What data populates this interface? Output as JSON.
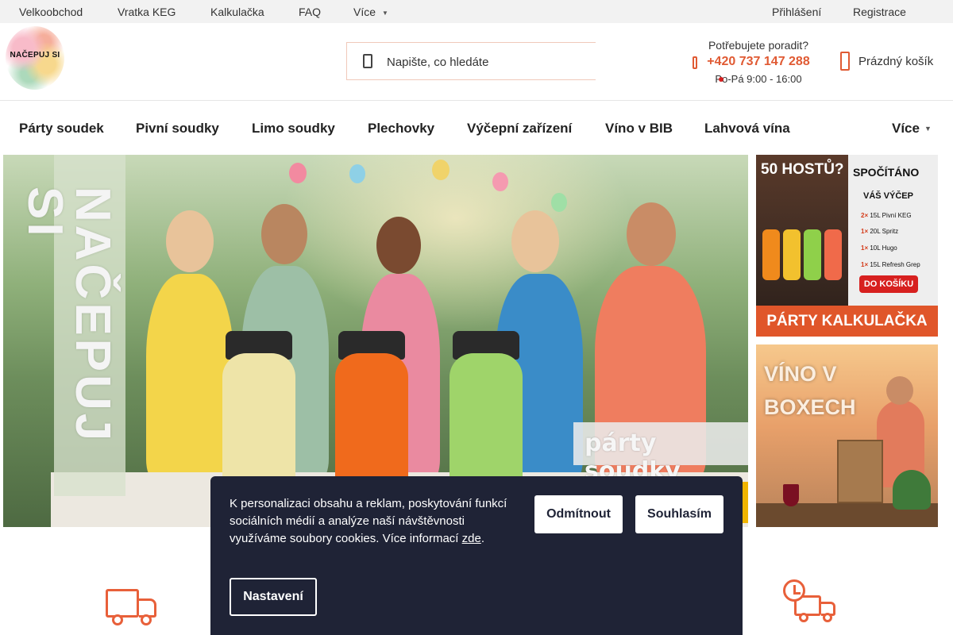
{
  "topbar": {
    "links": [
      "Velkoobchod",
      "Vratka KEG",
      "Kalkulačka",
      "FAQ",
      "Více"
    ],
    "login": "Přihlášení",
    "register": "Registrace"
  },
  "header": {
    "logo_text": "NAČEPUJ SI",
    "search_placeholder": "Napište, co hledáte",
    "contact_question": "Potřebujete poradit?",
    "contact_phone": "+420 737 147 288",
    "contact_hours": "Po-Pá 9:00 - 16:00",
    "cart_label": "Prázdný košík"
  },
  "nav": {
    "items": [
      "Párty soudek",
      "Pivní soudky",
      "Limo soudky",
      "Plechovky",
      "Výčepní zařízení",
      "Víno v BIB",
      "Lahvová vína"
    ],
    "more": "Více"
  },
  "hero": {
    "vertical_text": "NAČEPUJ SI",
    "tag": "párty soudky"
  },
  "side_banner_1": {
    "title_left": "50 HOSTŮ?",
    "title_right": "SPOČÍTÁNO",
    "box_heading": "VÁŠ VÝČEP",
    "items": [
      {
        "qty": "2×",
        "name": "15L Pivní KEG"
      },
      {
        "qty": "1×",
        "name": "20L Spritz"
      },
      {
        "qty": "1×",
        "name": "10L Hugo"
      },
      {
        "qty": "1×",
        "name": "15L Refresh Grep"
      }
    ],
    "button": "DO KOŠÍKU",
    "footer": "PÁRTY KALKULAČKA"
  },
  "side_banner_2": {
    "line1": "VÍNO V",
    "line2": "BOXECH"
  },
  "cookie": {
    "text": "K personalizaci obsahu a reklam, poskytování funkcí sociálních médií a analýze naší návštěvnosti využíváme soubory cookies. Více informací ",
    "link": "zde",
    "after_link": ".",
    "reject": "Odmítnout",
    "accept": "Souhlasím",
    "settings": "Nastavení"
  },
  "colors": {
    "accent": "#e05a33",
    "cookie_bg": "#1f2336",
    "topbar_bg": "#f2f2f2"
  }
}
